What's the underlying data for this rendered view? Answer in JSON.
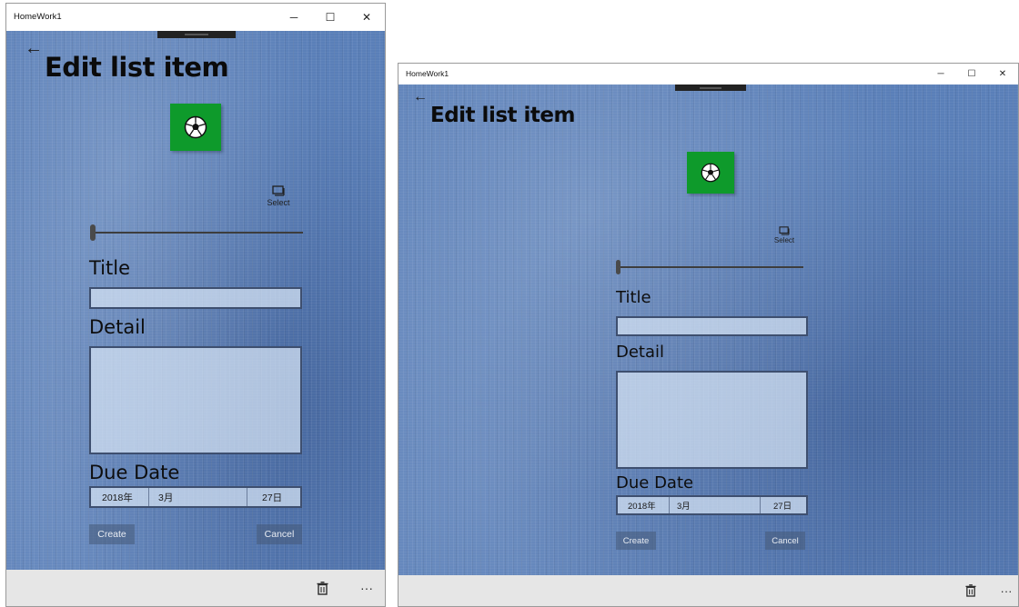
{
  "windows": [
    {
      "title": "HomeWork1",
      "controls": {
        "minimize": "─",
        "maximize": "☐",
        "close": "✕"
      },
      "back_glyph": "←",
      "page_title": "Edit list item",
      "image_icon": "soccer-ball-icon",
      "select_label": "Select",
      "slider_value": 0,
      "title_label": "Title",
      "title_value": "",
      "detail_label": "Detail",
      "detail_value": "",
      "due_date_label": "Due Date",
      "date": {
        "year": "2018年",
        "month": "3月",
        "day": "27日"
      },
      "create_label": "Create",
      "cancel_label": "Cancel",
      "more_glyph": "···"
    },
    {
      "title": "HomeWork1",
      "controls": {
        "minimize": "─",
        "maximize": "☐",
        "close": "✕"
      },
      "back_glyph": "←",
      "page_title": "Edit list item",
      "image_icon": "soccer-ball-icon",
      "select_label": "Select",
      "slider_value": 0,
      "title_label": "Title",
      "title_value": "",
      "detail_label": "Detail",
      "detail_value": "",
      "due_date_label": "Due Date",
      "date": {
        "year": "2018年",
        "month": "3月",
        "day": "27日"
      },
      "create_label": "Create",
      "cancel_label": "Cancel",
      "more_glyph": "···"
    }
  ],
  "colors": {
    "image_tile": "#0e9a2b",
    "background": "#5a7fb8",
    "command_bar": "#e6e6e6"
  }
}
